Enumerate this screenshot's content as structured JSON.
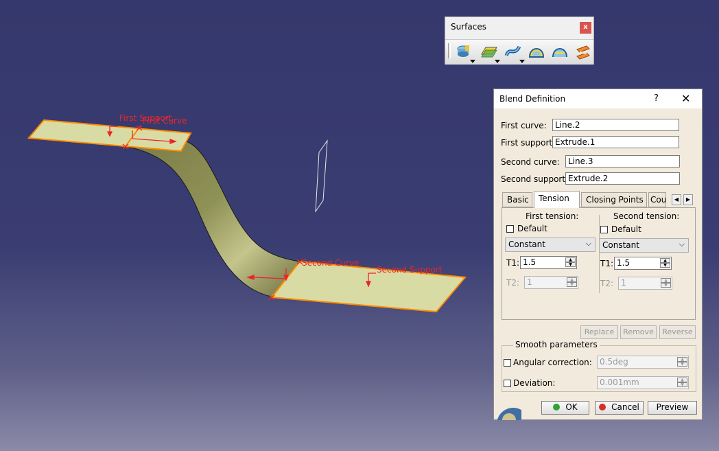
{
  "viewport": {
    "annotations": {
      "first_support": "First Support",
      "first_curve": "First Curve",
      "second_curve": "Second Curve",
      "second_support": "Second Support"
    }
  },
  "toolbar": {
    "title": "Surfaces",
    "close_label": "x",
    "icons": [
      "extrude-icon",
      "offset-icon",
      "sweep-icon",
      "fill-icon",
      "multi-section-icon",
      "blend-icon"
    ]
  },
  "dialog": {
    "title": "Blend Definition",
    "help_label": "?",
    "close_label": "✕",
    "first_curve_label": "First curve:",
    "first_curve_value": "Line.2",
    "first_support_label": "First support:",
    "first_support_value": "Extrude.1",
    "second_curve_label": "Second curve:",
    "second_curve_value": "Line.3",
    "second_support_label": "Second support:",
    "second_support_value": "Extrude.2",
    "tabs": [
      "Basic",
      "Tension",
      "Closing Points",
      "Cou"
    ],
    "active_tab": "Tension",
    "tension": {
      "first": {
        "heading": "First tension:",
        "default_label": "Default",
        "type": "Constant",
        "t1_label": "T1:",
        "t1_value": "1.5",
        "t2_label": "T2:",
        "t2_value": "1"
      },
      "second": {
        "heading": "Second tension:",
        "default_label": "Default",
        "type": "Constant",
        "t1_label": "T1:",
        "t1_value": "1.5",
        "t2_label": "T2:",
        "t2_value": "1"
      }
    },
    "replace_label": "Replace",
    "remove_label": "Remove",
    "reverse_label": "Reverse",
    "smooth": {
      "title": "Smooth parameters",
      "angular_label": "Angular correction:",
      "angular_value": "0.5deg",
      "deviation_label": "Deviation:",
      "deviation_value": "0.001mm"
    },
    "ok_label": "OK",
    "cancel_label": "Cancel",
    "preview_label": "Preview"
  },
  "colors": {
    "background_top": "#35386c",
    "surface_fill": "#d6d8a0",
    "highlight_edge": "#ff8c00",
    "annotation_text": "#e8262b"
  }
}
